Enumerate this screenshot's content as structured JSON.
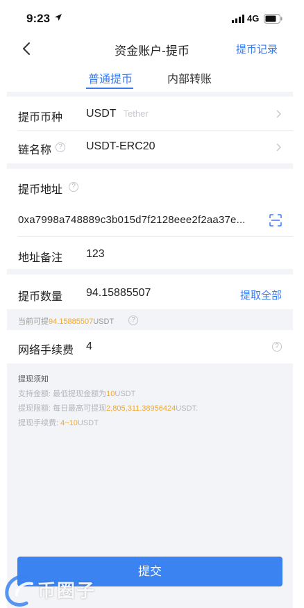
{
  "status_bar": {
    "time": "9:23",
    "network": "4G"
  },
  "nav": {
    "title": "资金账户-提币",
    "records_link": "提币记录"
  },
  "tabs": [
    {
      "label": "普通提币",
      "active": true
    },
    {
      "label": "内部转账",
      "active": false
    }
  ],
  "form": {
    "coin": {
      "label": "提币币种",
      "value": "USDT",
      "sub": "Tether"
    },
    "chain": {
      "label": "链名称",
      "value": "USDT-ERC20"
    },
    "address": {
      "label": "提币地址",
      "value": "0xa7998a748889c3b015d7f2128eee2f2aa37e..."
    },
    "memo": {
      "label": "地址备注",
      "value": "123"
    },
    "amount": {
      "label": "提币数量",
      "value": "94.15885507",
      "max_link": "提取全部"
    },
    "available": {
      "prefix": "当前可提",
      "amount": "94.15885507",
      "unit": "USDT"
    },
    "fee": {
      "label": "网络手续费",
      "value": "4"
    }
  },
  "notice": {
    "title": "提现须知",
    "min_prefix": "支持金额: 最低提现金额为",
    "min_value": "10",
    "min_unit": "USDT",
    "limit_prefix": "提现限额: 每日最高可提现",
    "limit_value": "2,805,311.38956424",
    "limit_unit": "USDT.",
    "fee_prefix": "提现手续费: ",
    "fee_value": "4~10",
    "fee_unit": "USDT"
  },
  "submit_label": "提交",
  "watermark": {
    "text": "币圈子"
  },
  "colors": {
    "accent": "#3a7bea",
    "highlight": "#f0a92e",
    "background": "#f3f4f7"
  }
}
